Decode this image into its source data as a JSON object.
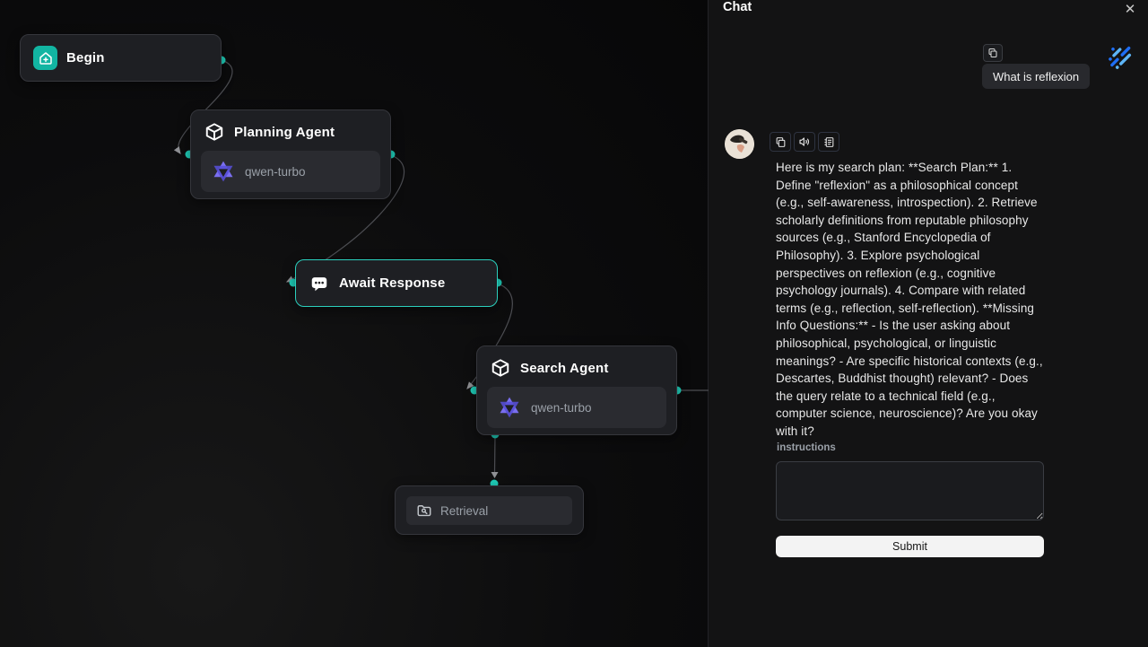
{
  "canvas": {
    "nodes": {
      "begin": {
        "title": "Begin"
      },
      "planning_agent": {
        "title": "Planning Agent",
        "model": "qwen-turbo"
      },
      "await_response": {
        "title": "Await Response"
      },
      "search_agent": {
        "title": "Search Agent",
        "model": "qwen-turbo"
      },
      "retrieval": {
        "title": "Retrieval"
      }
    },
    "icons": {
      "begin": "home-plus-icon",
      "agent": "cube-icon",
      "await": "message-dots-icon",
      "retrieval": "folder-search-icon"
    }
  },
  "chat": {
    "title": "Chat",
    "close_glyph": "✕",
    "user_message": "What is reflexion",
    "assistant_message": "Here is my search plan: **Search Plan:** 1. Define \"reflexion\" as a philosophical concept (e.g., self-awareness, introspection). 2. Retrieve scholarly definitions from reputable philosophy sources (e.g., Stanford Encyclopedia of Philosophy). 3. Explore psychological perspectives on reflexion (e.g., cognitive psychology journals). 4. Compare with related terms (e.g., reflection, self-reflection). **Missing Info Questions:** - Is the user asking about philosophical, psychological, or linguistic meanings? - Are specific historical contexts (e.g., Descartes, Buddhist thought) relevant? - Does the query relate to a technical field (e.g., computer science, neuroscience)? Are you okay with it?",
    "instructions_label": "instructions",
    "instructions_value": "",
    "submit_label": "Submit",
    "toolbar_icons": [
      "copy-icon",
      "speaker-icon",
      "log-icon"
    ]
  },
  "colors": {
    "accent_teal": "#12b5a2",
    "handle_teal": "#1fd0bb",
    "await_border": "#2bd0bd",
    "qwen_indigo": "#6f63ea",
    "logo_blue_dark": "#1e6ef5",
    "logo_blue_light": "#5db5f7"
  }
}
